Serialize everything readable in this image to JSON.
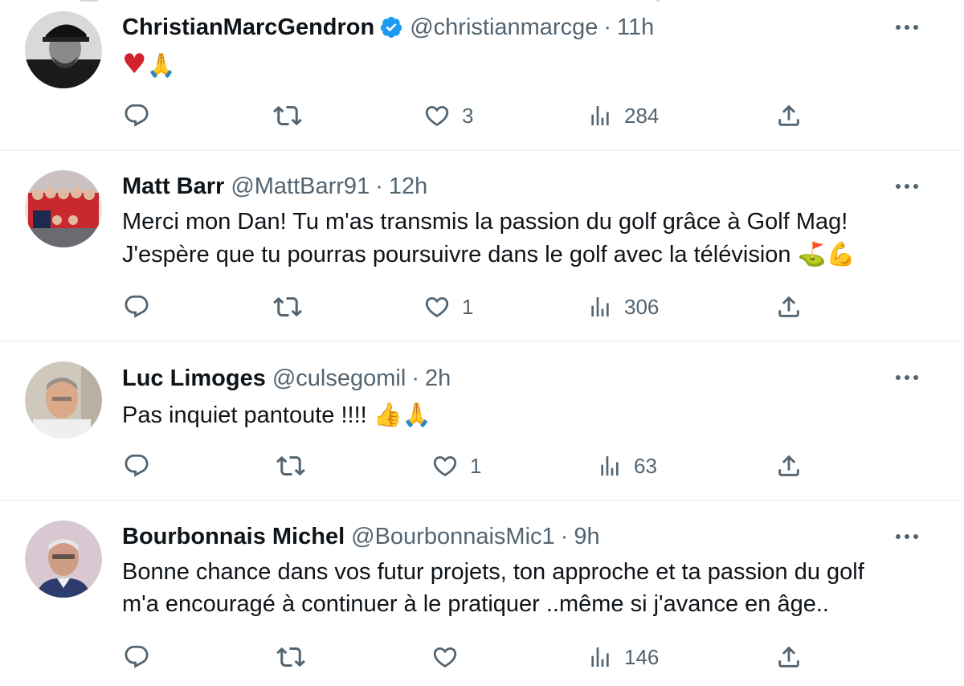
{
  "colors": {
    "text": "#0f1419",
    "secondary": "#536471",
    "border": "#eff3f4",
    "verified": "#1d9bf0",
    "heart": "#d2222d"
  },
  "tweets": [
    {
      "name": "ChristianMarcGendron",
      "verified": true,
      "handle": "@christianmarcge",
      "separator": "·",
      "time": "11h",
      "text": "",
      "emojis": [
        "♥",
        "🙏"
      ],
      "replies": "",
      "retweets": "",
      "likes": "3",
      "views": "284"
    },
    {
      "name": "Matt Barr",
      "verified": false,
      "handle": "@MattBarr91",
      "separator": "·",
      "time": "12h",
      "text_line1": "Merci mon Dan! Tu m'as transmis la passion du golf grâce à Golf Mag!",
      "text_line2": "J'espère que tu pourras poursuivre dans le golf avec la télévision",
      "emojis": [
        "⛳",
        "💪"
      ],
      "replies": "",
      "retweets": "",
      "likes": "1",
      "views": "306"
    },
    {
      "name": "Luc Limoges",
      "verified": false,
      "handle": "@culsegomil",
      "separator": "·",
      "time": "2h",
      "text": "Pas inquiet pantoute !!!!",
      "emojis": [
        "👍",
        "🙏"
      ],
      "replies": "",
      "retweets": "",
      "likes": "1",
      "views": "63"
    },
    {
      "name": "Bourbonnais Michel",
      "verified": false,
      "handle": "@BourbonnaisMic1",
      "separator": "·",
      "time": "9h",
      "text_line1": "Bonne chance dans vos futur projets, ton approche et ta passion du golf",
      "text_line2": "m'a encouragé à continuer à  le pratiquer ..même si j'avance en âge..",
      "replies": "",
      "retweets": "",
      "likes": "",
      "views": "146"
    }
  ],
  "icons": {
    "reply": "reply-icon",
    "retweet": "retweet-icon",
    "like": "like-icon",
    "views": "views-icon",
    "share": "share-icon",
    "more": "more-icon",
    "verified": "verified-badge-icon"
  }
}
